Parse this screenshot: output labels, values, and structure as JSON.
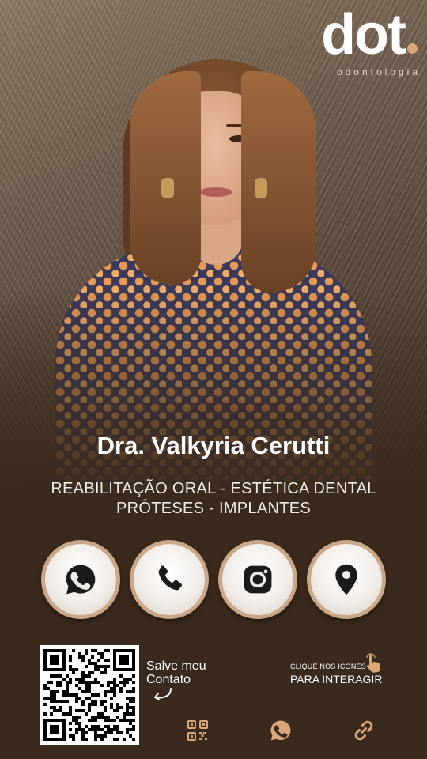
{
  "brand": {
    "logo_word": "dot",
    "logo_subtitle": "odontologia",
    "accent_color": "#d9a676"
  },
  "profile": {
    "name": "Dra. Valkyria Cerutti",
    "specialties_line1": "REABILITAÇÃO ORAL - ESTÉTICA DENTAL",
    "specialties_line2": "PRÓTESES - IMPLANTES"
  },
  "contact_buttons": [
    {
      "icon": "whatsapp-icon"
    },
    {
      "icon": "phone-icon"
    },
    {
      "icon": "instagram-icon"
    },
    {
      "icon": "location-pin-icon"
    }
  ],
  "footer": {
    "save_contact": "Salve meu Contato",
    "hint_small": "CLIQUE NOS ÍCONES",
    "hint_big": "PARA INTERAGIR",
    "bottom_icons": [
      "qr-code-icon",
      "whatsapp-icon",
      "link-icon"
    ]
  },
  "colors": {
    "background": "#3a2a1d",
    "button_ring": "#c9a889",
    "icon_fill": "#1b1b1b",
    "text": "#ffffff"
  }
}
